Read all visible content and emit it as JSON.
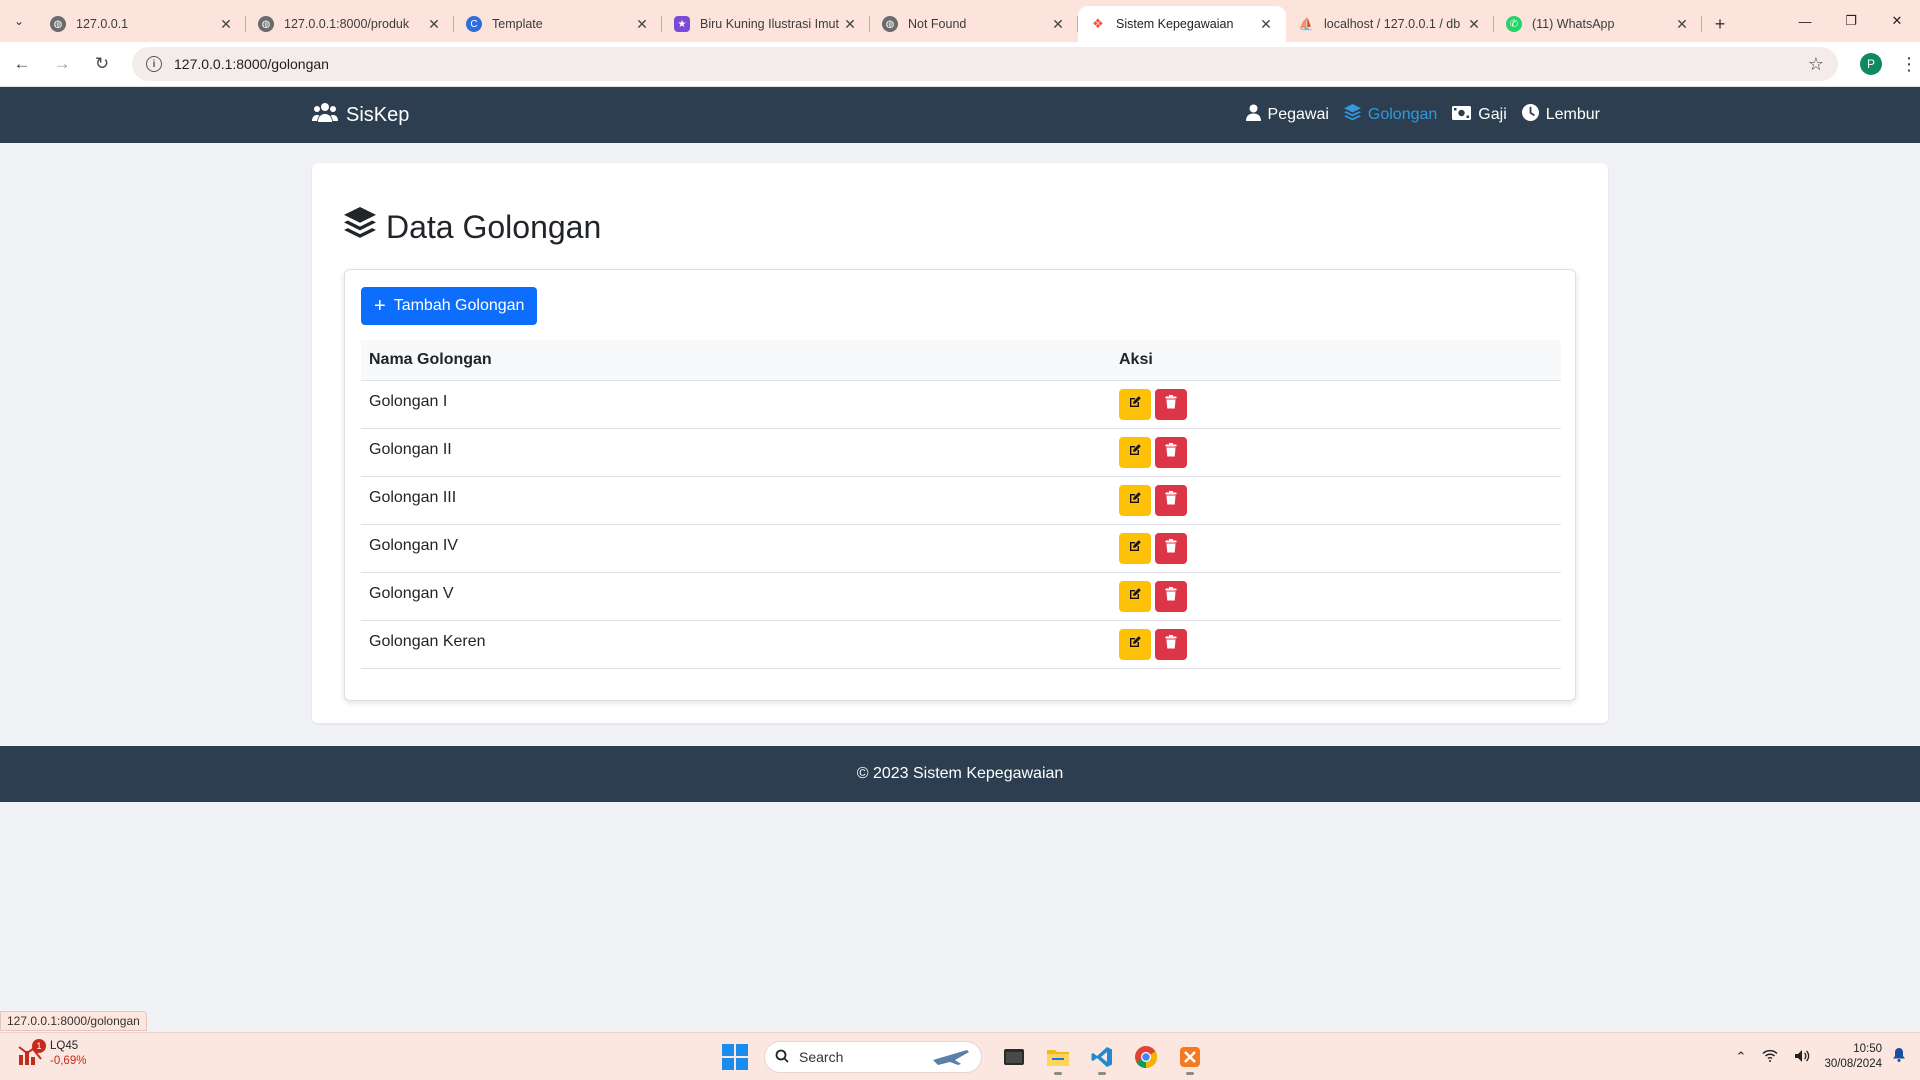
{
  "browser": {
    "tabs": [
      {
        "title": "127.0.0.1",
        "favicon": "globe-icon"
      },
      {
        "title": "127.0.0.1:8000/produk",
        "favicon": "globe-icon"
      },
      {
        "title": "Template",
        "favicon": "canva-icon"
      },
      {
        "title": "Biru Kuning Ilustrasi Imut",
        "favicon": "design-icon"
      },
      {
        "title": "Not Found",
        "favicon": "globe-icon"
      },
      {
        "title": "Sistem Kepegawaian",
        "favicon": "laravel-icon",
        "active": true
      },
      {
        "title": "localhost / 127.0.0.1 / db",
        "favicon": "phpmyadmin-icon"
      },
      {
        "title": "(11) WhatsApp",
        "favicon": "whatsapp-icon"
      }
    ],
    "url": "127.0.0.1:8000/golongan",
    "profile_initial": "P",
    "status_url": "127.0.0.1:8000/golongan"
  },
  "navbar": {
    "brand": "SisKep",
    "links": [
      {
        "label": "Pegawai",
        "icon": "user-icon"
      },
      {
        "label": "Golongan",
        "icon": "layers-icon",
        "active": true
      },
      {
        "label": "Gaji",
        "icon": "money-icon"
      },
      {
        "label": "Lembur",
        "icon": "clock-icon"
      }
    ]
  },
  "page": {
    "title": "Data Golongan",
    "add_button": "Tambah Golongan",
    "table": {
      "headers": [
        "Nama Golongan",
        "Aksi"
      ],
      "rows": [
        "Golongan I",
        "Golongan II",
        "Golongan III",
        "Golongan IV",
        "Golongan V",
        "Golongan Keren"
      ]
    }
  },
  "footer": {
    "text": "© 2023 Sistem Kepegawaian"
  },
  "taskbar": {
    "stock_symbol": "LQ45",
    "stock_change": "-0,69%",
    "stock_badge": "1",
    "search_label": "Search",
    "time": "10:50",
    "date": "30/08/2024"
  },
  "colors": {
    "navbar_bg": "#2c3e50",
    "nav_active": "#3498db",
    "primary": "#0d6efd",
    "warning": "#ffc107",
    "danger": "#dc3545"
  }
}
